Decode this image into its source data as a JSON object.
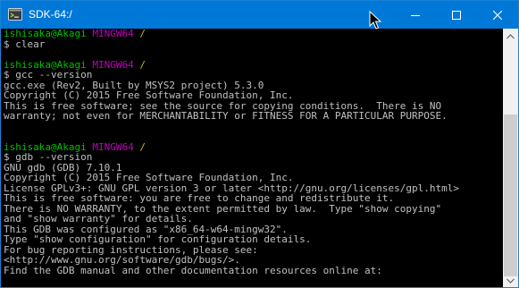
{
  "window": {
    "title": "SDK-64:/"
  },
  "caption_buttons": {
    "minimize": "minimize-icon",
    "maximize": "maximize-icon",
    "close": "close-icon"
  },
  "colors": {
    "titlebar": "#0078d7",
    "terminal_bg": "#000000",
    "terminal_fg": "#c0c0c0",
    "prompt_user": "#00c000",
    "prompt_system": "#c000c0",
    "prompt_path": "#c0c000"
  },
  "terminal": {
    "lines": [
      {
        "type": "prompt",
        "user": "ishisaka@Akagi",
        "system": "MINGW64",
        "path": "/"
      },
      {
        "type": "text",
        "text": "$ clear"
      },
      {
        "type": "text",
        "text": ""
      },
      {
        "type": "prompt",
        "user": "ishisaka@Akagi",
        "system": "MINGW64",
        "path": "/"
      },
      {
        "type": "text",
        "text": "$ gcc --version"
      },
      {
        "type": "text",
        "text": "gcc.exe (Rev2, Built by MSYS2 project) 5.3.0"
      },
      {
        "type": "text",
        "text": "Copyright (C) 2015 Free Software Foundation, Inc."
      },
      {
        "type": "text",
        "text": "This is free software; see the source for copying conditions.  There is NO"
      },
      {
        "type": "text",
        "text": "warranty; not even for MERCHANTABILITY or FITNESS FOR A PARTICULAR PURPOSE."
      },
      {
        "type": "text",
        "text": ""
      },
      {
        "type": "text",
        "text": ""
      },
      {
        "type": "prompt",
        "user": "ishisaka@Akagi",
        "system": "MINGW64",
        "path": "/"
      },
      {
        "type": "text",
        "text": "$ gdb --version"
      },
      {
        "type": "text",
        "text": "GNU gdb (GDB) 7.10.1"
      },
      {
        "type": "text",
        "text": "Copyright (C) 2015 Free Software Foundation, Inc."
      },
      {
        "type": "text",
        "text": "License GPLv3+: GNU GPL version 3 or later <http://gnu.org/licenses/gpl.html>"
      },
      {
        "type": "text",
        "text": "This is free software: you are free to change and redistribute it."
      },
      {
        "type": "text",
        "text": "There is NO WARRANTY, to the extent permitted by law.  Type \"show copying\""
      },
      {
        "type": "text",
        "text": "and \"show warranty\" for details."
      },
      {
        "type": "text",
        "text": "This GDB was configured as \"x86_64-w64-mingw32\"."
      },
      {
        "type": "text",
        "text": "Type \"show configuration\" for configuration details."
      },
      {
        "type": "text",
        "text": "For bug reporting instructions, please see:"
      },
      {
        "type": "text",
        "text": "<http://www.gnu.org/software/gdb/bugs/>."
      },
      {
        "type": "text",
        "text": "Find the GDB manual and other documentation resources online at:"
      }
    ]
  }
}
